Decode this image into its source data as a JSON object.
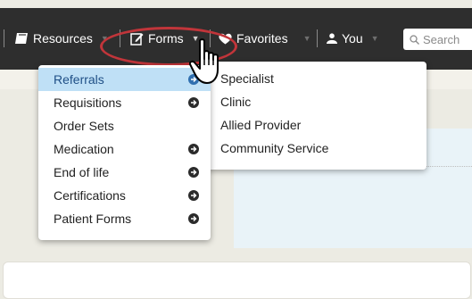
{
  "navbar": {
    "items": [
      {
        "label": "Resources",
        "icon": "resources-book-icon"
      },
      {
        "label": "Forms",
        "icon": "forms-edit-icon"
      },
      {
        "label": "Favorites",
        "icon": "heart-icon"
      },
      {
        "label": "You",
        "icon": "user-icon"
      }
    ],
    "search": {
      "placeholder": "Search",
      "icon": "search-icon"
    }
  },
  "forms_menu": {
    "items": [
      {
        "label": "Referrals",
        "has_submenu": true,
        "active": true
      },
      {
        "label": "Requisitions",
        "has_submenu": true
      },
      {
        "label": "Order Sets",
        "has_submenu": false
      },
      {
        "label": "Medication",
        "has_submenu": true
      },
      {
        "label": "End of life",
        "has_submenu": true
      },
      {
        "label": "Certifications",
        "has_submenu": true
      },
      {
        "label": "Patient Forms",
        "has_submenu": true
      }
    ]
  },
  "referrals_submenu": {
    "items": [
      {
        "label": "Specialist"
      },
      {
        "label": "Clinic"
      },
      {
        "label": "Allied Provider"
      },
      {
        "label": "Community Service"
      }
    ]
  },
  "colors": {
    "navbar_bg": "#2e2e2e",
    "highlight_circle": "#c1353a",
    "active_item_bg": "#bfe0f6",
    "active_item_text": "#1f4f86"
  }
}
